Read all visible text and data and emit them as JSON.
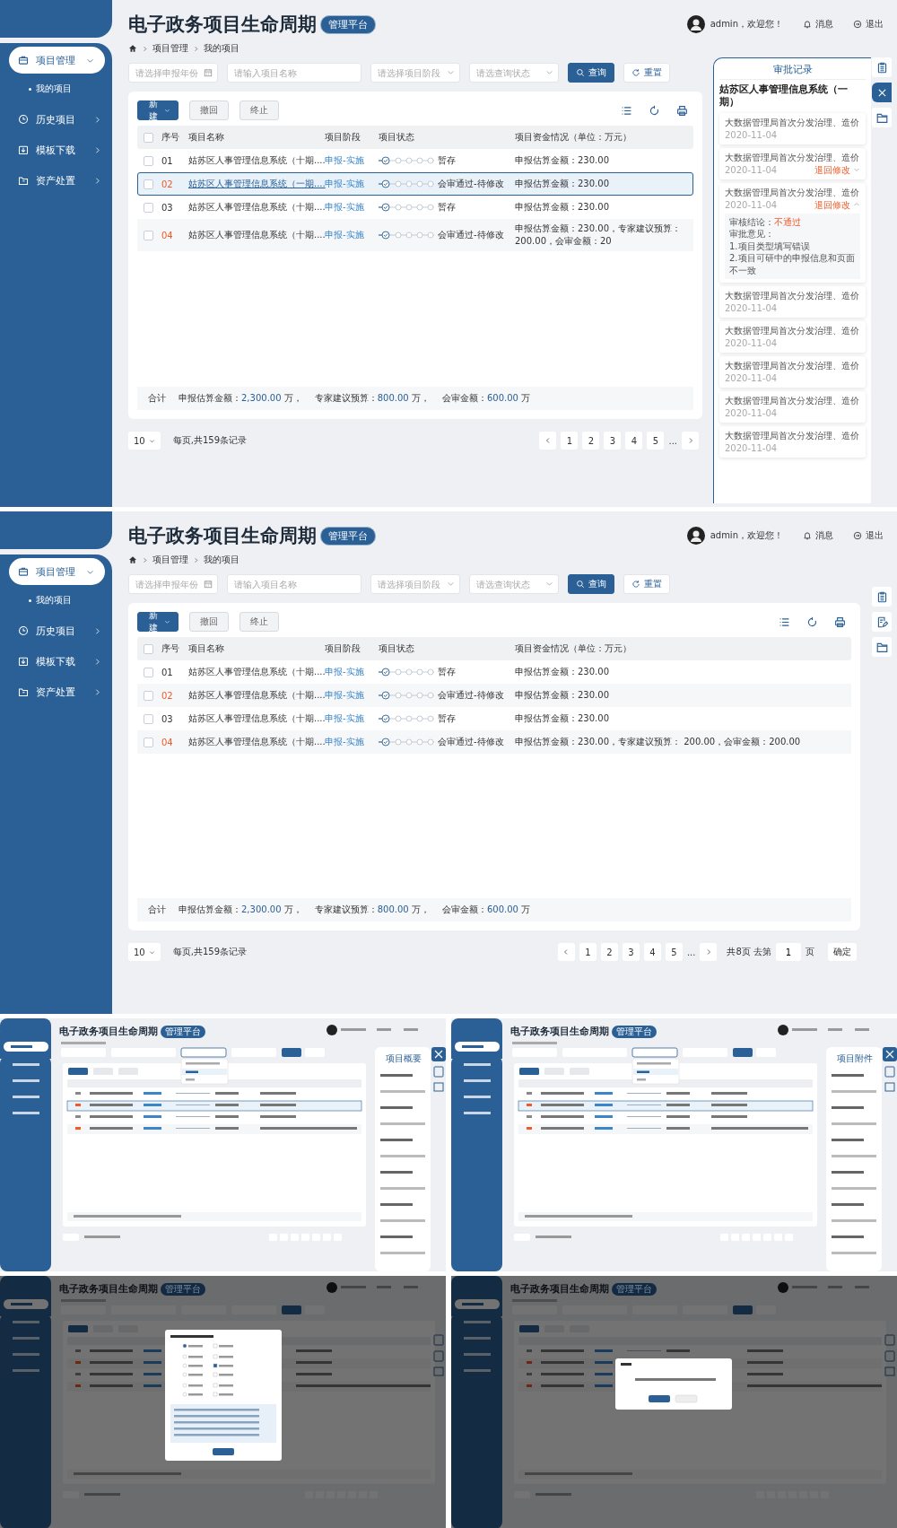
{
  "screens": [
    {
      "header": {
        "title": "电子政务项目生命周期",
        "badge": "管理平台",
        "user": "admin，欢迎您！",
        "messages": "消息",
        "logout": "退出"
      },
      "nav": [
        {
          "label": "项目管理",
          "selected": true,
          "expanded": true,
          "children": [
            {
              "label": "我的项目"
            }
          ]
        },
        {
          "label": "历史项目",
          "selected": false,
          "expanded": false
        },
        {
          "label": "模板下载",
          "selected": false,
          "expanded": false
        },
        {
          "label": "资产处置",
          "selected": false,
          "expanded": false
        }
      ],
      "breadcrumb": [
        "项目管理",
        "我的项目"
      ],
      "filters": [
        {
          "kind": "date",
          "placeholder": "请选择申报年份"
        },
        {
          "kind": "text",
          "placeholder": "请输入项目名称"
        },
        {
          "kind": "select",
          "placeholder": "请选择项目阶段"
        },
        {
          "kind": "select",
          "placeholder": "请选查询状态"
        }
      ],
      "search_button": "查询",
      "reset_button": "重置",
      "toolbar": {
        "new": "新建",
        "withdraw": "撤回",
        "terminate": "终止"
      },
      "table": {
        "select_all_checked": false,
        "columns": [
          "序号",
          "项目名称",
          "项目阶段",
          "项目状态",
          "项目资金情况（单位：万元）"
        ],
        "rows": [
          {
            "checked": false,
            "selected": false,
            "flagged": false,
            "no": "01",
            "name": "姑苏区人事管理信息系统（十期....",
            "stage": "申报-实施",
            "status": "暂存",
            "funds": "申报估算金额：230.00"
          },
          {
            "checked": false,
            "selected": true,
            "flagged": true,
            "no": "02",
            "name": "姑苏区人事管理信息系统（一期....",
            "stage": "申报-实施",
            "status": "会审通过-待修改",
            "funds": "申报估算金额：230.00"
          },
          {
            "checked": false,
            "selected": false,
            "flagged": false,
            "no": "03",
            "name": "姑苏区人事管理信息系统（十期....",
            "stage": "申报-实施",
            "status": "暂存",
            "funds": "申报估算金额：230.00"
          },
          {
            "checked": false,
            "selected": false,
            "flagged": true,
            "no": "04",
            "name": "姑苏区人事管理信息系统（十期....",
            "stage": "申报-实施",
            "status": "会审通过-待修改",
            "funds": "申报估算金额：230.00，专家建议预算： 200.00，会审金额：20"
          }
        ]
      },
      "totals": {
        "label": "合计",
        "items": [
          {
            "label": "申报估算金额：",
            "value": "2,300.00",
            "unit": " 万，"
          },
          {
            "label": "专家建议预算：",
            "value": "800.00",
            "unit": " 万，"
          },
          {
            "label": "会审金额：",
            "value": "600.00",
            "unit": " 万"
          }
        ]
      },
      "pagination": {
        "page_size": "10",
        "summary": "每页,共159条记录",
        "pages": [
          "1",
          "2",
          "3",
          "4",
          "5"
        ],
        "ellipsis": "..."
      },
      "drawer": {
        "title": "审批记录",
        "project": "姑苏区人事管理信息系统（一期）",
        "records": [
          {
            "title": "大数据管理局首次分发治理、造价",
            "date": "2020-11-04"
          },
          {
            "title": "大数据管理局首次分发治理、造价",
            "date": "2020-11-04",
            "status": "退回修改",
            "expanded": false
          },
          {
            "title": "大数据管理局首次分发治理、造价",
            "date": "2020-11-04",
            "status": "退回修改",
            "expanded": true,
            "conclusion_label": "审核结论：",
            "conclusion": "不通过",
            "opinion_label": "审批意见：",
            "opinions": [
              "1.项目类型填写错误",
              "2.项目可研中的申报信息和页面不一致"
            ]
          },
          {
            "title": "大数据管理局首次分发治理、造价",
            "date": "2020-11-04"
          },
          {
            "title": "大数据管理局首次分发治理、造价",
            "date": "2020-11-04"
          },
          {
            "title": "大数据管理局首次分发治理、造价",
            "date": "2020-11-04"
          },
          {
            "title": "大数据管理局首次分发治理、造价",
            "date": "2020-11-04"
          },
          {
            "title": "大数据管理局首次分发治理、造价",
            "date": "2020-11-04"
          }
        ]
      },
      "rail": [
        {
          "kind": "records",
          "selected": false
        },
        {
          "kind": "close",
          "selected": true
        },
        {
          "kind": "files",
          "selected": false
        }
      ]
    },
    {
      "header": {
        "title": "电子政务项目生命周期",
        "badge": "管理平台",
        "user": "admin，欢迎您！",
        "messages": "消息",
        "logout": "退出"
      },
      "nav": [
        {
          "label": "项目管理",
          "selected": true,
          "expanded": true,
          "children": [
            {
              "label": "我的项目"
            }
          ]
        },
        {
          "label": "历史项目",
          "selected": false,
          "expanded": false
        },
        {
          "label": "模板下载",
          "selected": false,
          "expanded": false
        },
        {
          "label": "资产处置",
          "selected": false,
          "expanded": false
        }
      ],
      "breadcrumb": [
        "项目管理",
        "我的项目"
      ],
      "filters": [
        {
          "kind": "date",
          "placeholder": "请选择申报年份"
        },
        {
          "kind": "text",
          "placeholder": "请输入项目名称"
        },
        {
          "kind": "select",
          "placeholder": "请选择项目阶段"
        },
        {
          "kind": "select",
          "placeholder": "请选查询状态"
        }
      ],
      "search_button": "查询",
      "reset_button": "重置",
      "toolbar": {
        "new": "新建",
        "withdraw": "撤回",
        "terminate": "终止"
      },
      "table": {
        "select_all_checked": false,
        "columns": [
          "序号",
          "项目名称",
          "项目阶段",
          "项目状态",
          "项目资金情况（单位：万元）"
        ],
        "rows": [
          {
            "checked": false,
            "selected": false,
            "flagged": false,
            "no": "01",
            "name": "姑苏区人事管理信息系统（十期....",
            "stage": "申报-实施",
            "status": "暂存",
            "funds": "申报估算金额：230.00"
          },
          {
            "checked": false,
            "selected": false,
            "flagged": true,
            "no": "02",
            "name": "姑苏区人事管理信息系统（十期....",
            "stage": "申报-实施",
            "status": "会审通过-待修改",
            "funds": "申报估算金额：230.00"
          },
          {
            "checked": false,
            "selected": false,
            "flagged": false,
            "no": "03",
            "name": "姑苏区人事管理信息系统（十期....",
            "stage": "申报-实施",
            "status": "暂存",
            "funds": "申报估算金额：230.00"
          },
          {
            "checked": false,
            "selected": false,
            "flagged": true,
            "no": "04",
            "name": "姑苏区人事管理信息系统（十期....",
            "stage": "申报-实施",
            "status": "会审通过-待修改",
            "funds": "申报估算金额：230.00，专家建议预算： 200.00，会审金额：200.00"
          }
        ]
      },
      "totals": {
        "label": "合计",
        "items": [
          {
            "label": "申报估算金额：",
            "value": "2,300.00",
            "unit": " 万，"
          },
          {
            "label": "专家建议预算：",
            "value": "800.00",
            "unit": " 万，"
          },
          {
            "label": "会审金额：",
            "value": "600.00",
            "unit": " 万"
          }
        ]
      },
      "pagination": {
        "page_size": "10",
        "summary": "每页,共159条记录",
        "pages": [
          "1",
          "2",
          "3",
          "4",
          "5"
        ],
        "ellipsis": "...",
        "goto_prefix": "共8页 去第",
        "goto_value": "1",
        "goto_suffix": "页",
        "goto_button": "确定"
      },
      "rail": [
        {
          "kind": "records",
          "selected": false
        },
        {
          "kind": "edit",
          "selected": false
        },
        {
          "kind": "files",
          "selected": false
        }
      ]
    }
  ],
  "thumbnails": [
    {
      "kind": "drawer",
      "title": "电子政务项目生命周期",
      "badge": "管理平台",
      "panel_title": "项目概要"
    },
    {
      "kind": "drawer",
      "title": "电子政务项目生命周期",
      "badge": "管理平台",
      "panel_title": "项目附件"
    },
    {
      "kind": "choice-dialog",
      "title": "电子政务项目生命周期",
      "badge": "管理平台"
    },
    {
      "kind": "confirm-dialog",
      "title": "电子政务项目生命周期",
      "badge": "管理平台"
    }
  ]
}
